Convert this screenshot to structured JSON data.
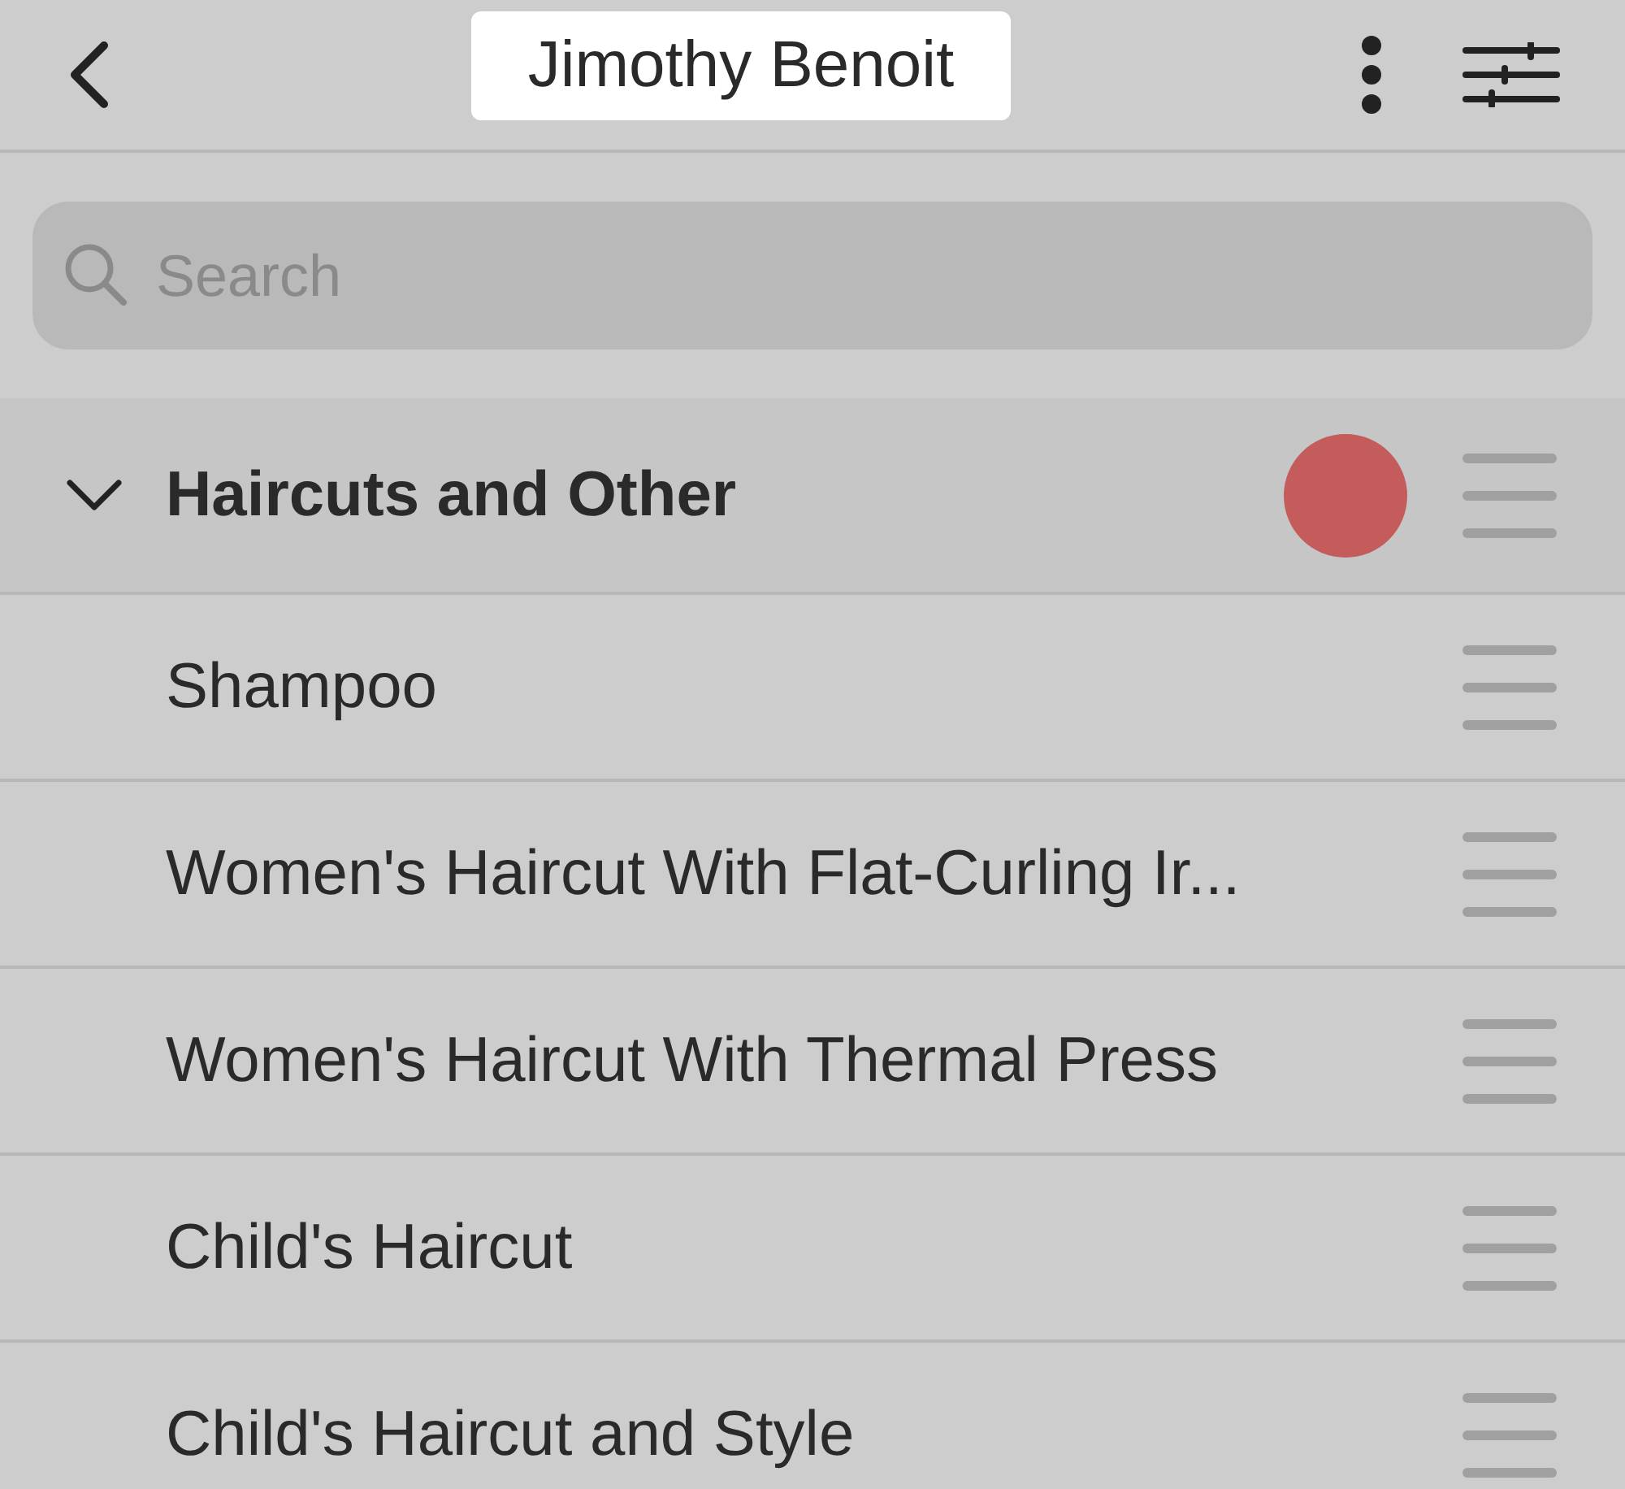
{
  "header": {
    "title": "Jimothy Benoit"
  },
  "search": {
    "placeholder": "Search"
  },
  "category": {
    "name": "Haircuts and Other",
    "expanded": true,
    "color": "#c45c5c",
    "items": [
      {
        "name": "Shampoo"
      },
      {
        "name": "Women's Haircut With Flat-Curling Ir..."
      },
      {
        "name": "Women's Haircut With Thermal Press"
      },
      {
        "name": "Child's Haircut"
      },
      {
        "name": "Child's Haircut and Style"
      }
    ]
  }
}
